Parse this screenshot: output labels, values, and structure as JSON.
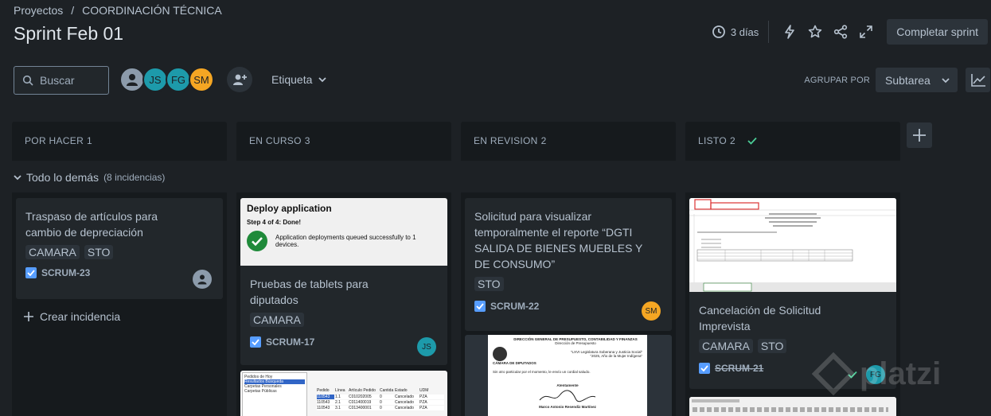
{
  "breadcrumb": {
    "items": [
      "Proyectos",
      "COORDINACIÓN TÉCNICA"
    ],
    "separator": "/"
  },
  "page_title": "Sprint Feb 01",
  "header": {
    "days_remaining": "3 días",
    "complete_sprint_label": "Completar sprint"
  },
  "toolbar": {
    "search_placeholder": "Buscar",
    "avatars": [
      {
        "initials": "",
        "color": "#8c9bab"
      },
      {
        "initials": "JS",
        "color": "#1d9aaa"
      },
      {
        "initials": "FG",
        "color": "#1d9aaa"
      },
      {
        "initials": "SM",
        "color": "#f5a623"
      }
    ],
    "label_filter": "Etiqueta",
    "group_by_label": "AGRUPAR POR",
    "group_by_value": "Subtarea"
  },
  "columns": [
    {
      "name": "POR HACER",
      "count": "1"
    },
    {
      "name": "EN CURSO",
      "count": "3"
    },
    {
      "name": "EN REVISION",
      "count": "2"
    },
    {
      "name": "LISTO",
      "count": "2"
    }
  ],
  "swimlane": {
    "title": "Todo lo demás",
    "count": "(8 incidencias)"
  },
  "cards": {
    "todo_1": {
      "title": "Traspaso de artículos para cambio de depreciación",
      "tags": [
        "CAMARA",
        "STO"
      ],
      "key": "SCRUM-23"
    },
    "inprogress_1": {
      "thumb_title": "Deploy application",
      "thumb_step": "Step 4 of 4: Done!",
      "thumb_msg": "Application deployments queued successfully to 1 devices.",
      "title": "Pruebas de tablets para diputados",
      "tags": [
        "CAMARA"
      ],
      "key": "SCRUM-17",
      "assignee": "JS"
    },
    "inprogress_2": {
      "tree_items": [
        "Pedidos de Hoy",
        "Resultados Búsqueda",
        "Carpetas Personales",
        "Carpetas Públicas"
      ],
      "table_headers": [
        "Pedido",
        "Línea",
        "Artículo Pedido",
        "Cantida",
        "Estado",
        "UDM"
      ],
      "table_rows": [
        [
          "110543",
          "1.1",
          "C010202005",
          "0",
          "Cancelado",
          "PZA"
        ],
        [
          "110543",
          "2.1",
          "C011400019",
          "0",
          "Cancelado",
          "PZA"
        ],
        [
          "110543",
          "3.1",
          "C013400001",
          "0",
          "Cancelado",
          "PZA"
        ]
      ]
    },
    "review_1": {
      "title": "Solicitud para visualizar temporalmente el reporte “DGTI SALIDA DE BIENES MUEBLES Y DE CONSUMO”",
      "tags": [
        "STO"
      ],
      "key": "SCRUM-22",
      "assignee": "SM"
    },
    "review_2": {
      "doc_header": "DIRECCIÓN GENERAL DE PRESUPUESTO, CONTABILIDAD Y FINANZAS",
      "doc_sub": "Dirección de Presupuesto",
      "doc_leg1": "“LXVI Legislatura Soberana y Justicia Social”",
      "doc_leg2": "“2025, Año de la Mujer Indígena”",
      "doc_org": "CÁMARA DE DIPUTADOS",
      "doc_body": "Sin otro particular por el momento, le envío un cordial saludo.",
      "doc_closing": "Atentamente",
      "doc_sign": "Marco Antonio Resendiz Martínez"
    },
    "done_1": {
      "title": "Cancelación de Solicitud Imprevista",
      "tags": [
        "CAMARA",
        "STO"
      ],
      "key": "SCRUM-21",
      "assignee": "FG"
    }
  },
  "create_issue_label": "Crear incidencia",
  "watermark": "platzi"
}
